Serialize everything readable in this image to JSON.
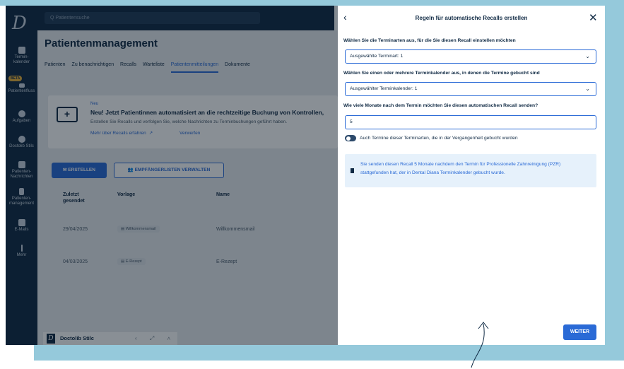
{
  "app": {
    "search_placeholder": "Q  Patientensuche",
    "logo": "D"
  },
  "rail": {
    "items": [
      {
        "label": "Termin-\nkalender",
        "icon": "calendar-icon"
      },
      {
        "label": "Patientenfluss",
        "icon": "patient-flow-icon",
        "badge": "BETA"
      },
      {
        "label": "Aufgaben",
        "icon": "check-circle-icon"
      },
      {
        "label": "Doctolib Stilc",
        "icon": "users-icon"
      },
      {
        "label": "Patienten-\nNachrichten",
        "icon": "chat-icon"
      },
      {
        "label": "Patienten-\nmanagement",
        "icon": "clipboard-icon"
      },
      {
        "label": "E-Mails",
        "icon": "mail-icon"
      },
      {
        "label": "Mehr",
        "icon": "more-icon"
      }
    ]
  },
  "main": {
    "title": "Patientenmanagement",
    "tabs": [
      "Patienten",
      "Zu benachrichtigen",
      "Recalls",
      "Warteliste",
      "Patientenmitteilungen",
      "Dokumente"
    ],
    "banner": {
      "badge": "Neu",
      "headline": "Neu! Jetzt Patientinnen automatisiert an die rechtzeitige Buchung von Kontrollen,",
      "description": "Erstellen Sie Recalls und verfolgen Sie, welche Nachrichten zu Terminbuchungen geführt haben.",
      "link_more": "Mehr über Recalls erfahren",
      "link_dismiss": "Verwerfen"
    },
    "buttons": {
      "create": "ERSTELLEN",
      "manage_lists": "EMPFÄNGERLISTEN VERWALTEN"
    },
    "table": {
      "headers": [
        "Zuletzt gesendet",
        "Vorlage",
        "Name"
      ],
      "rows": [
        {
          "date": "29/04/2025",
          "template": "Willkommensmail",
          "name": "Willkommensmail"
        },
        {
          "date": "04/03/2025",
          "template": "E-Rezept",
          "name": "E-Rezept"
        }
      ]
    },
    "footer": {
      "name": "Doctolib Stilc",
      "controls": "‹ ⤢ ∧"
    }
  },
  "panel": {
    "back": "‹",
    "title": "Regeln für automatische Recalls erstellen",
    "close": "✕",
    "q1": "Wählen Sie die Terminarten aus, für die Sie diesen Recall einstellen möchten",
    "select1": "Ausgewählte Terminart: 1",
    "q2": "Wählen Sie einen oder mehrere Terminkalender aus, in denen die Termine gebucht sind",
    "select2": "Ausgewählter Terminkalender: 1",
    "q3": "Wie viele Monate nach dem Termin möchten Sie diesen automatischen Recall senden?",
    "months_value": "5",
    "toggle_label": "Auch Termine dieser Terminarten, die in der Vergangenheit gebucht wurden",
    "info": "Sie senden diesen Recall 5 Monate nachdem den Termin für Professionelle Zahnreinigung (PZR) stattgefunden hat, der in Dental Diana Terminkalender gebucht wurde.",
    "next": "WEITER"
  }
}
